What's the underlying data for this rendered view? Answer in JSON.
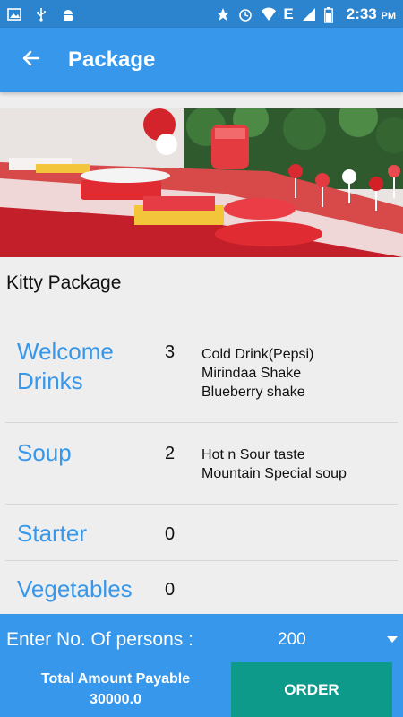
{
  "status_bar": {
    "time": "2:33",
    "ampm": "PM",
    "network": "E"
  },
  "app_bar": {
    "title": "Package"
  },
  "package": {
    "name": "Kitty Package"
  },
  "menu": [
    {
      "category": "Welcome Drinks",
      "count": "3",
      "items": [
        "Cold Drink(Pepsi)",
        "Mirindaa Shake",
        "Blueberry shake"
      ]
    },
    {
      "category": "Soup",
      "count": "2",
      "items": [
        "Hot n Sour taste",
        "Mountain Special soup"
      ]
    },
    {
      "category": "Starter",
      "count": "0",
      "items": []
    },
    {
      "category": "Vegetables",
      "count": "0",
      "items": []
    }
  ],
  "order_form": {
    "persons_label": "Enter No. Of persons :",
    "persons_value": "200",
    "total_label": "Total Amount Payable",
    "total_amount": "30000.0",
    "order_button": "ORDER"
  },
  "colors": {
    "status_bar": "#2d84ce",
    "app_bar": "#3797ea",
    "accent": "#3797ea",
    "order_button": "#0d9a8a",
    "background": "#eeeeee"
  }
}
